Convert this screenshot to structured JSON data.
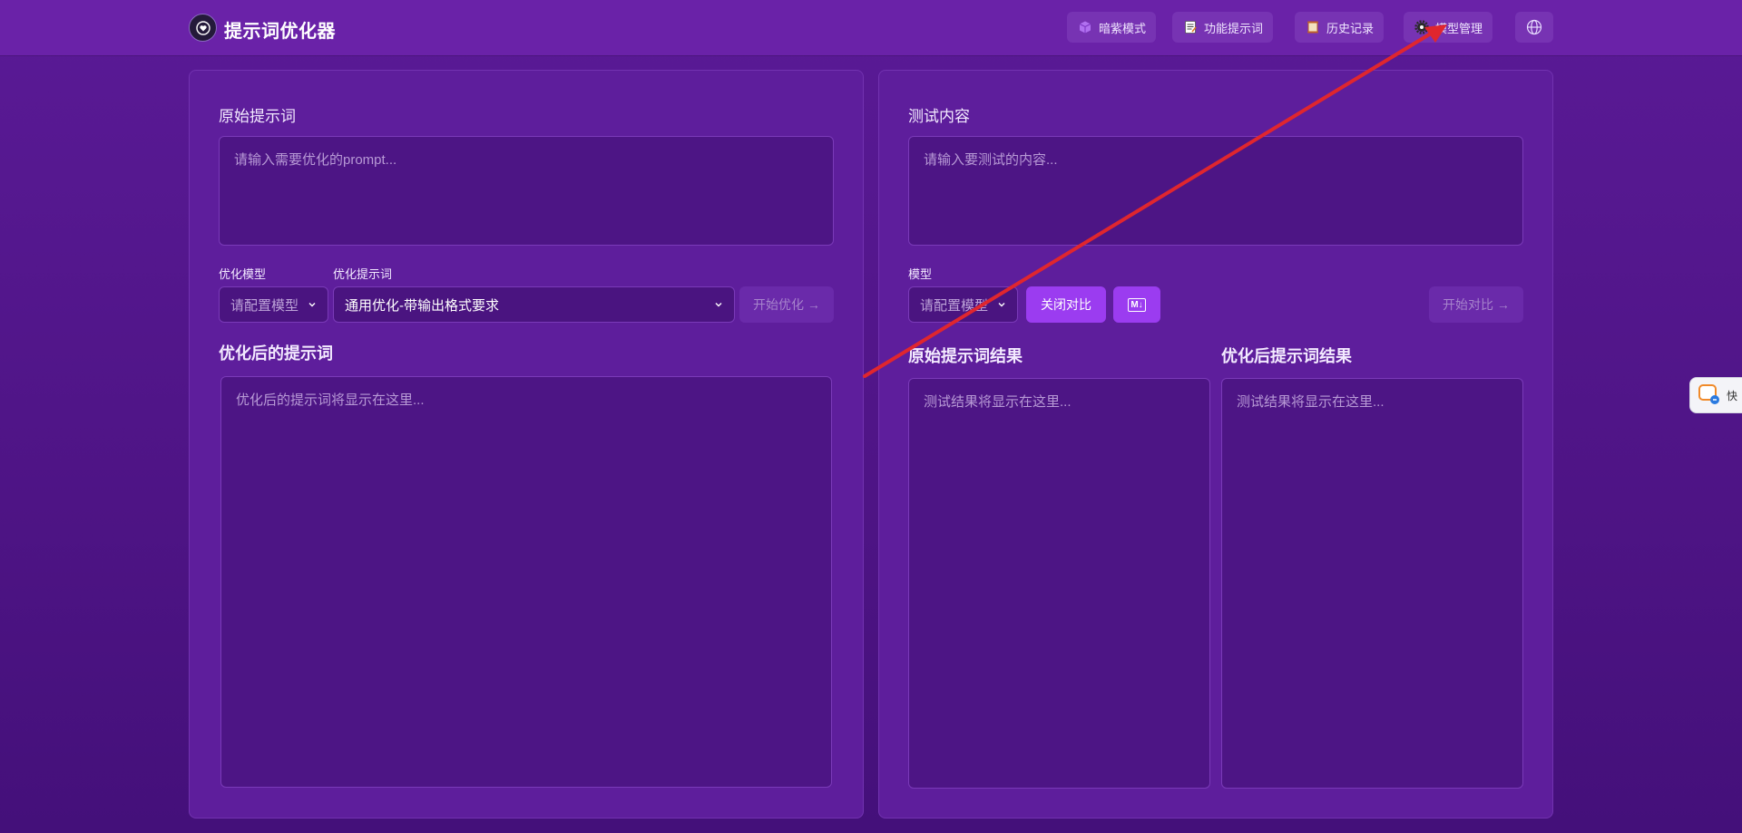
{
  "app": {
    "title": "提示词优化器"
  },
  "nav": {
    "dark_mode": "暗紫模式",
    "feature_prompts": "功能提示词",
    "history": "历史记录",
    "model_manage": "模型管理"
  },
  "left": {
    "original_label": "原始提示词",
    "original_placeholder": "请输入需要优化的prompt...",
    "opt_model_label": "优化模型",
    "opt_prompt_label": "优化提示词",
    "model_select_value": "请配置模型",
    "prompt_select_value": "通用优化-带输出格式要求",
    "start_optimize": "开始优化 →",
    "optimized_label": "优化后的提示词",
    "optimized_placeholder": "优化后的提示词将显示在这里..."
  },
  "right": {
    "test_label": "测试内容",
    "test_placeholder": "请输入要测试的内容...",
    "model_label": "模型",
    "model_select_value": "请配置模型",
    "close_compare": "关闭对比",
    "markdown_toggle": "M↓",
    "start_compare": "开始对比 →",
    "original_result_label": "原始提示词结果",
    "optimized_result_label": "优化后提示词结果",
    "result_placeholder": "测试结果将显示在这里..."
  },
  "side_widget": {
    "label": "快"
  },
  "colors": {
    "background": "#4e1485",
    "topbar": "#6a22a8",
    "panel": "#5e1e9c",
    "accent": "#9b3cf0",
    "annotation_arrow": "#e0262e"
  }
}
